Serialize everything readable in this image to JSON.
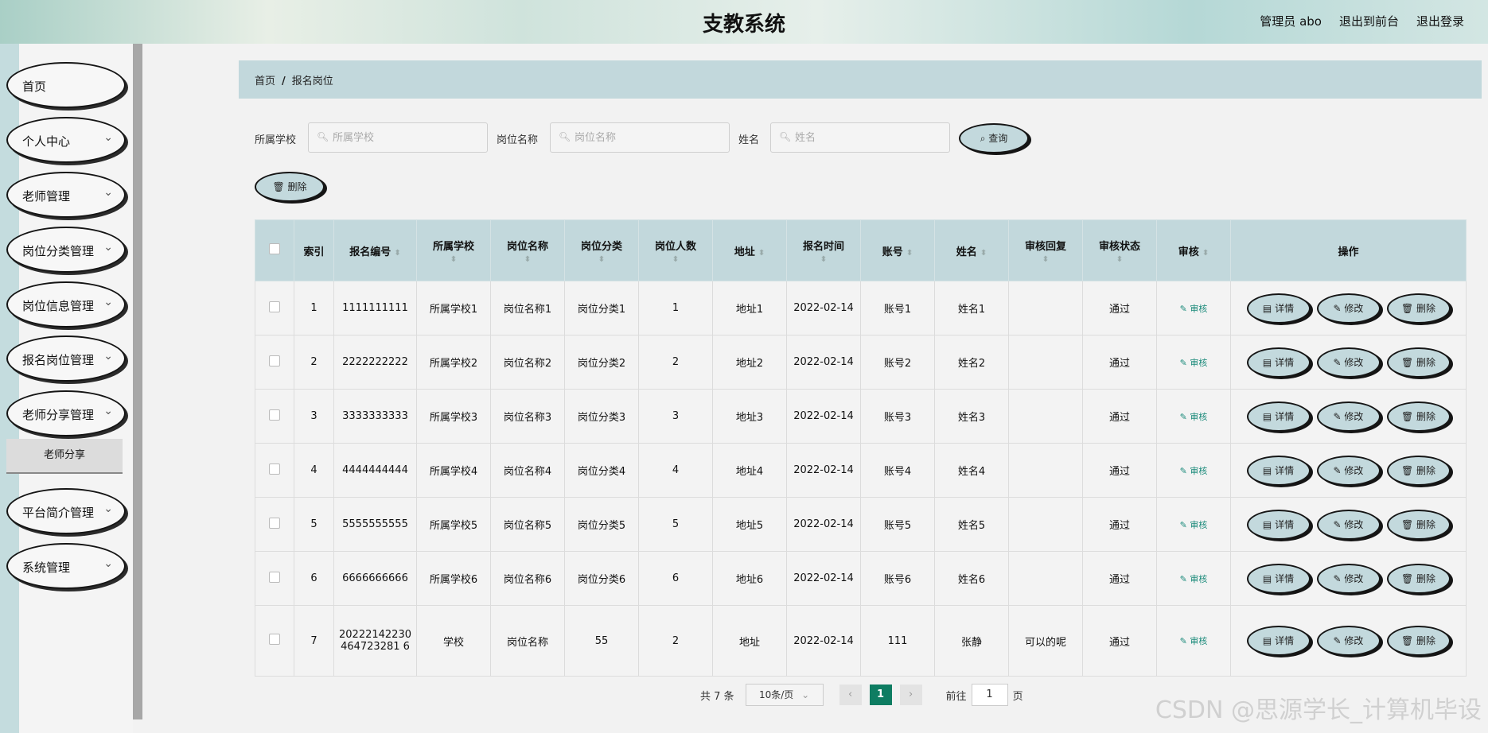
{
  "header": {
    "title": "支教系统",
    "user": "管理员 abo",
    "to_front": "退出到前台",
    "logout": "退出登录"
  },
  "sidebar": {
    "items": [
      {
        "label": "首页"
      },
      {
        "label": "个人中心"
      },
      {
        "label": "老师管理"
      },
      {
        "label": "岗位分类管理"
      },
      {
        "label": "岗位信息管理"
      },
      {
        "label": "报名岗位管理"
      },
      {
        "label": "老师分享管理"
      },
      {
        "label": "平台简介管理"
      },
      {
        "label": "系统管理"
      }
    ],
    "submenu": "老师分享"
  },
  "breadcrumb": {
    "home": "首页",
    "sep": "/",
    "current": "报名岗位"
  },
  "filters": {
    "school_label": "所属学校",
    "school_placeholder": "所属学校",
    "position_label": "岗位名称",
    "position_placeholder": "岗位名称",
    "name_label": "姓名",
    "name_placeholder": "姓名",
    "query": "查询"
  },
  "bulk_delete": "删除",
  "table": {
    "headers": {
      "index": "索引",
      "reg_no": "报名编号",
      "school": "所属学校",
      "position": "岗位名称",
      "category": "岗位分类",
      "count": "岗位人数",
      "address": "地址",
      "time": "报名时间",
      "account": "账号",
      "name": "姓名",
      "reply": "审核回复",
      "status": "审核状态",
      "audit": "审核",
      "ops": "操作"
    },
    "rows": [
      {
        "index": "1",
        "reg_no": "1111111111",
        "school": "所属学校1",
        "position": "岗位名称1",
        "category": "岗位分类1",
        "count": "1",
        "address": "地址1",
        "time": "2022-02-14",
        "account": "账号1",
        "name": "姓名1",
        "reply": "",
        "status": "通过"
      },
      {
        "index": "2",
        "reg_no": "2222222222",
        "school": "所属学校2",
        "position": "岗位名称2",
        "category": "岗位分类2",
        "count": "2",
        "address": "地址2",
        "time": "2022-02-14",
        "account": "账号2",
        "name": "姓名2",
        "reply": "",
        "status": "通过"
      },
      {
        "index": "3",
        "reg_no": "3333333333",
        "school": "所属学校3",
        "position": "岗位名称3",
        "category": "岗位分类3",
        "count": "3",
        "address": "地址3",
        "time": "2022-02-14",
        "account": "账号3",
        "name": "姓名3",
        "reply": "",
        "status": "通过"
      },
      {
        "index": "4",
        "reg_no": "4444444444",
        "school": "所属学校4",
        "position": "岗位名称4",
        "category": "岗位分类4",
        "count": "4",
        "address": "地址4",
        "time": "2022-02-14",
        "account": "账号4",
        "name": "姓名4",
        "reply": "",
        "status": "通过"
      },
      {
        "index": "5",
        "reg_no": "5555555555",
        "school": "所属学校5",
        "position": "岗位名称5",
        "category": "岗位分类5",
        "count": "5",
        "address": "地址5",
        "time": "2022-02-14",
        "account": "账号5",
        "name": "姓名5",
        "reply": "",
        "status": "通过"
      },
      {
        "index": "6",
        "reg_no": "6666666666",
        "school": "所属学校6",
        "position": "岗位名称6",
        "category": "岗位分类6",
        "count": "6",
        "address": "地址6",
        "time": "2022-02-14",
        "account": "账号6",
        "name": "姓名6",
        "reply": "",
        "status": "通过"
      },
      {
        "index": "7",
        "reg_no": "20222142230464723281 6",
        "school": "学校",
        "position": "岗位名称",
        "category": "55",
        "count": "2",
        "address": "地址",
        "time": "2022-02-14",
        "account": "111",
        "name": "张静",
        "reply": "可以的呢",
        "status": "通过"
      }
    ],
    "audit_link": "审核",
    "detail": "详情",
    "edit": "修改",
    "delete": "删除"
  },
  "pagination": {
    "total": "共 7 条",
    "page_size": "10条/页",
    "current_page": "1",
    "goto_label": "前往",
    "goto_value": "1",
    "page_unit": "页"
  },
  "watermark": "CSDN @思源学长_计算机毕设"
}
